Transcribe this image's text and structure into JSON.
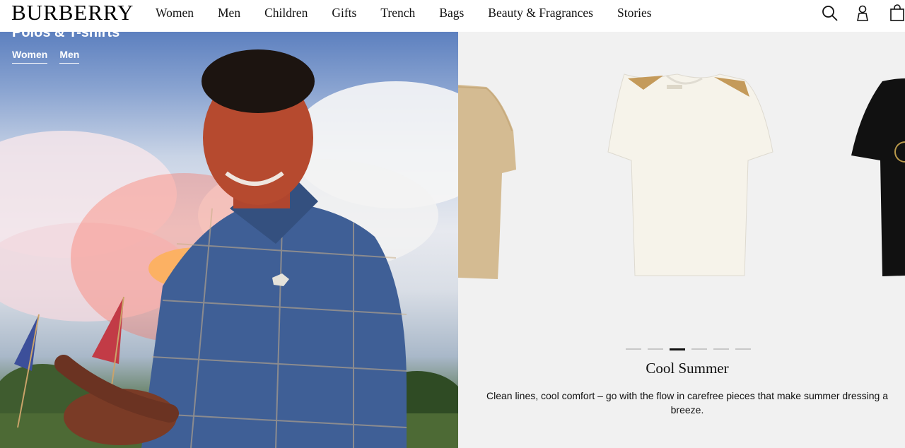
{
  "header": {
    "logo": "BURBERRY",
    "nav": [
      "Women",
      "Men",
      "Children",
      "Gifts",
      "Trench",
      "Bags",
      "Beauty & Fragrances",
      "Stories"
    ],
    "icons": [
      "search-icon",
      "account-icon",
      "shopping-bag-icon"
    ]
  },
  "hero": {
    "title": "Polos & T-shirts",
    "links": [
      "Women",
      "Men"
    ]
  },
  "carousel": {
    "dots_count": 6,
    "active_index": 2
  },
  "promo": {
    "title": "Cool Summer",
    "text": "Clean lines, cool comfort – go with the flow in carefree pieces that make summer dressing a breeze."
  }
}
